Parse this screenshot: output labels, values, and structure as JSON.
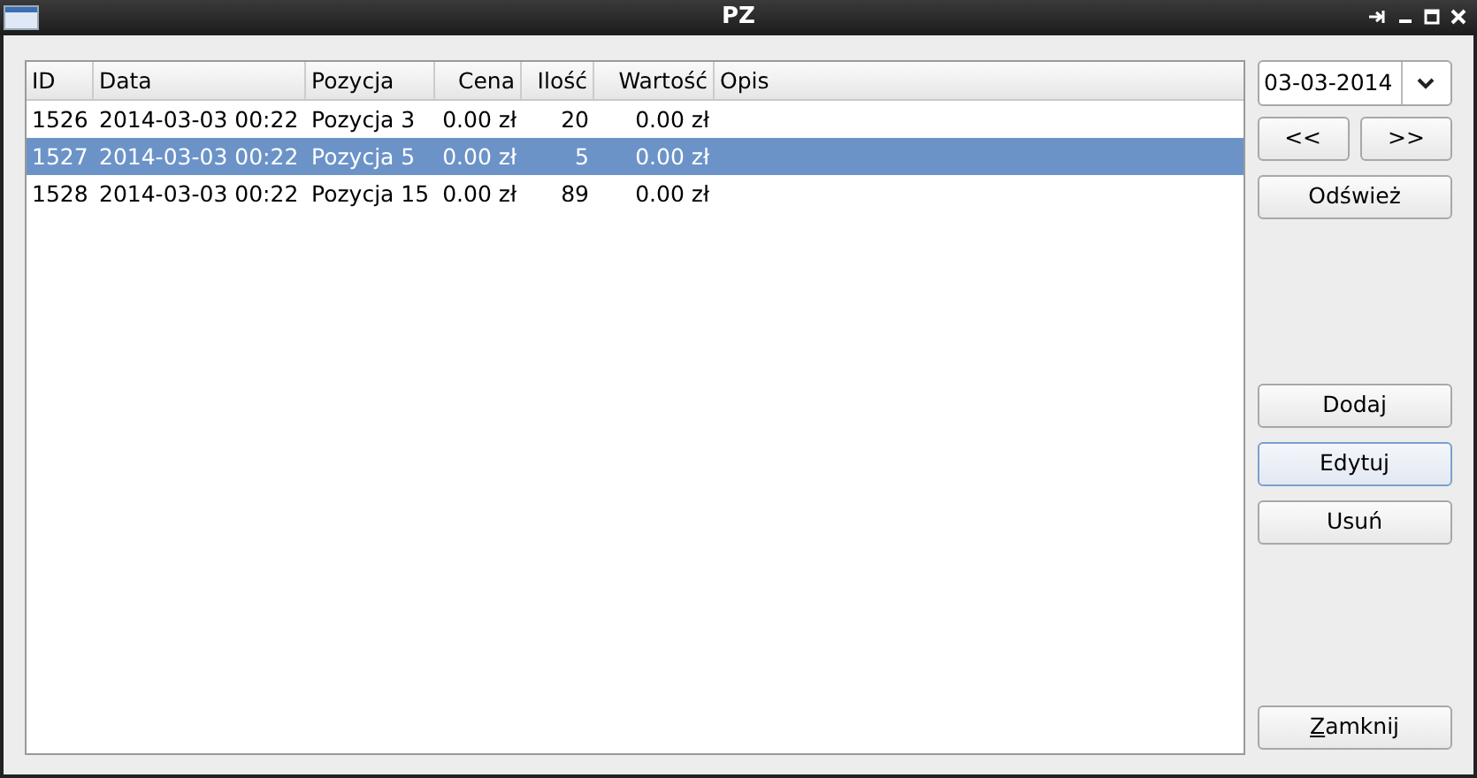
{
  "window": {
    "title": "PZ"
  },
  "table": {
    "columns": [
      {
        "label": "ID",
        "right_aligned": false
      },
      {
        "label": "Data",
        "right_aligned": false
      },
      {
        "label": "Pozycja",
        "right_aligned": false
      },
      {
        "label": "Cena",
        "right_aligned": true
      },
      {
        "label": "Ilość",
        "right_aligned": true
      },
      {
        "label": "Wartość",
        "right_aligned": true
      },
      {
        "label": "Opis",
        "right_aligned": false
      }
    ],
    "rows": [
      {
        "selected": false,
        "cells": [
          "1526",
          "2014-03-03 00:22",
          "Pozycja 3",
          "0.00 zł",
          "20",
          "0.00 zł",
          ""
        ]
      },
      {
        "selected": true,
        "cells": [
          "1527",
          "2014-03-03 00:22",
          "Pozycja 5",
          "0.00 zł",
          "5",
          "0.00 zł",
          ""
        ]
      },
      {
        "selected": false,
        "cells": [
          "1528",
          "2014-03-03 00:22",
          "Pozycja 15",
          "0.00 zł",
          "89",
          "0.00 zł",
          ""
        ]
      }
    ]
  },
  "date_field": {
    "value": "03-03-2014"
  },
  "buttons": [
    {
      "kind": "nav",
      "label": "<<",
      "focused": false,
      "mnemonic_first": false
    },
    {
      "kind": "nav",
      "label": ">>",
      "focused": false,
      "mnemonic_first": false
    },
    {
      "kind": "top",
      "label": "Odśwież",
      "focused": false,
      "mnemonic_first": false
    },
    {
      "kind": "middle",
      "label": "Dodaj",
      "focused": false,
      "mnemonic_first": false
    },
    {
      "kind": "middle",
      "label": "Edytuj",
      "focused": true,
      "mnemonic_first": false
    },
    {
      "kind": "middle",
      "label": "Usuń",
      "focused": false,
      "mnemonic_first": false
    },
    {
      "kind": "bottom",
      "label": "Zamknij",
      "focused": false,
      "mnemonic_first": true
    }
  ]
}
